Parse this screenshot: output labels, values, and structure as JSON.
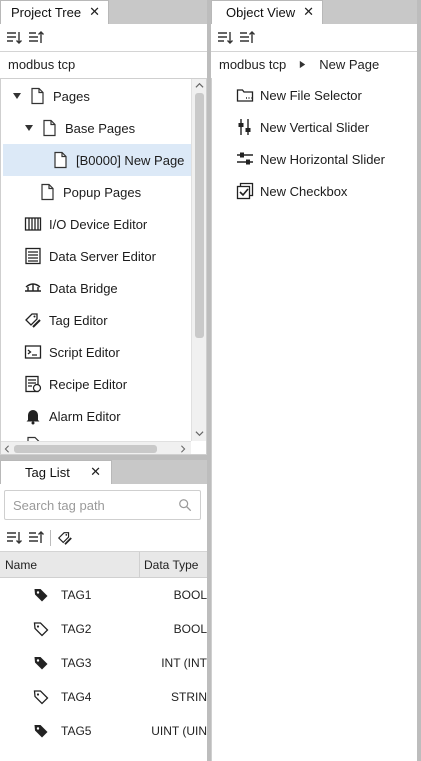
{
  "project_tree": {
    "tab_label": "Project Tree",
    "close_glyph": "✕",
    "breadcrumb": "modbus tcp",
    "items": [
      {
        "label": "Pages",
        "icon": "page-icon"
      },
      {
        "label": "Base Pages",
        "icon": "page-icon"
      },
      {
        "label": "[B0000] New Page",
        "icon": "page-icon"
      },
      {
        "label": "Popup Pages",
        "icon": "page-icon"
      },
      {
        "label": "I/O Device Editor",
        "icon": "io-device-icon"
      },
      {
        "label": "Data Server Editor",
        "icon": "data-server-icon"
      },
      {
        "label": "Data Bridge",
        "icon": "data-bridge-icon"
      },
      {
        "label": "Tag Editor",
        "icon": "tag-editor-icon"
      },
      {
        "label": "Script Editor",
        "icon": "script-icon"
      },
      {
        "label": "Recipe Editor",
        "icon": "recipe-icon"
      },
      {
        "label": "Alarm Editor",
        "icon": "bell-icon"
      }
    ]
  },
  "object_view": {
    "tab_label": "Object View",
    "close_glyph": "✕",
    "breadcrumb_root": "modbus tcp",
    "breadcrumb_current": "New Page",
    "items": [
      {
        "label": "New File Selector",
        "icon": "file-selector-icon"
      },
      {
        "label": "New Vertical Slider",
        "icon": "vertical-slider-icon"
      },
      {
        "label": "New Horizontal Slider",
        "icon": "horizontal-slider-icon"
      },
      {
        "label": "New Checkbox",
        "icon": "checkbox-icon"
      }
    ]
  },
  "tag_list": {
    "tab_label": "Tag List",
    "close_glyph": "✕",
    "search_placeholder": "Search tag path",
    "columns": {
      "name": "Name",
      "data_type": "Data Type"
    },
    "rows": [
      {
        "name": "TAG1",
        "data_type": "BOOL",
        "icon": "tag-filled-icon"
      },
      {
        "name": "TAG2",
        "data_type": "BOOL",
        "icon": "tag-outline-icon"
      },
      {
        "name": "TAG3",
        "data_type": "INT (INT",
        "icon": "tag-filled-icon"
      },
      {
        "name": "TAG4",
        "data_type": "STRIN",
        "icon": "tag-outline-icon"
      },
      {
        "name": "TAG5",
        "data_type": "UINT (UIN",
        "icon": "tag-filled-icon"
      }
    ]
  },
  "colors": {
    "selection": "#dce9f7",
    "tab_strip": "#c8c8c8",
    "header_bg": "#e8e8e8"
  }
}
